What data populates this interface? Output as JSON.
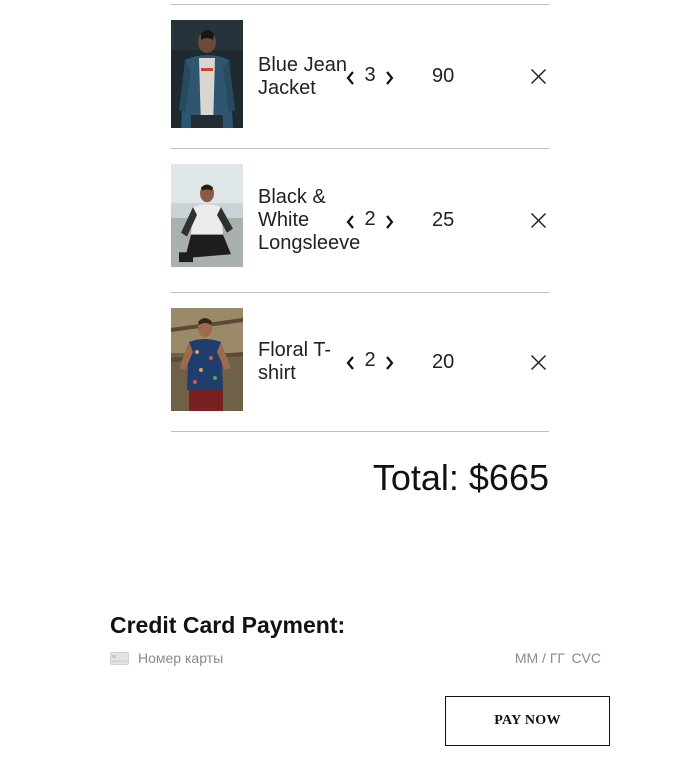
{
  "cart": {
    "items": [
      {
        "name": "Blue Jean Jacket",
        "quantity": "3",
        "price": "90",
        "image": "blue-jean-jacket-photo"
      },
      {
        "name": "Black & White Longsleeve",
        "quantity": "2",
        "price": "25",
        "image": "black-white-longsleeve-photo"
      },
      {
        "name": "Floral T-shirt",
        "quantity": "2",
        "price": "20",
        "image": "floral-tshirt-photo"
      }
    ],
    "total_label": "Total: $665"
  },
  "payment": {
    "title": "Credit Card Payment:",
    "card_number_placeholder": "Номер карты",
    "expiry_placeholder": "ММ / ГГ",
    "cvc_placeholder": "CVC",
    "pay_button_label": "PAY NOW"
  },
  "icons": {
    "decrease": "chevron-left-icon",
    "increase": "chevron-right-icon",
    "remove": "close-icon",
    "card": "credit-card-icon"
  },
  "colors": {
    "divider": "#bdbdbd",
    "text": "#111111",
    "placeholder": "#8a8a8a"
  }
}
